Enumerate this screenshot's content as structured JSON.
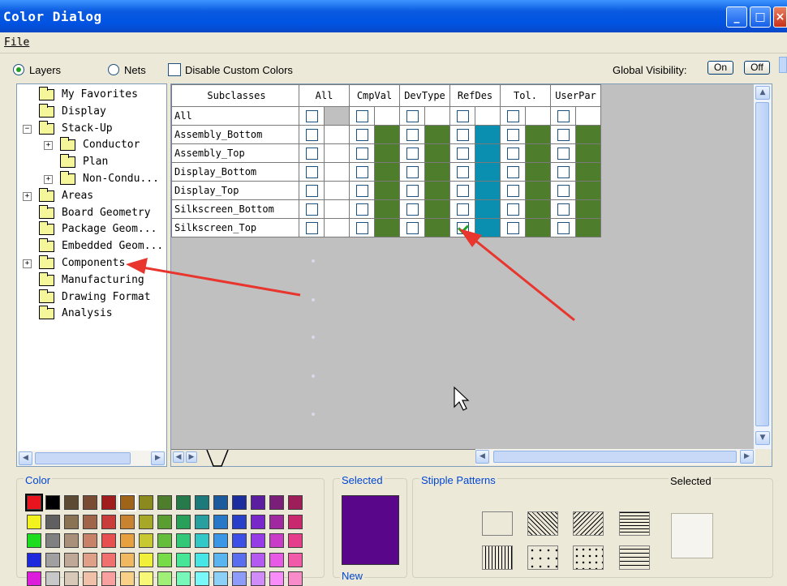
{
  "window": {
    "title": "Color Dialog",
    "minimize": "_",
    "maximize": "□",
    "close": "×"
  },
  "menu": {
    "file": "File"
  },
  "options": {
    "layers_label": "Layers",
    "nets_label": "Nets",
    "disable_custom_colors": "Disable Custom Colors",
    "global_visibility_label": "Global Visibility:",
    "on_button": "On",
    "off_button": "Off"
  },
  "tree": [
    {
      "label": "My Favorites",
      "level": 0,
      "expander": ""
    },
    {
      "label": "Display",
      "level": 0,
      "expander": ""
    },
    {
      "label": "Stack-Up",
      "level": 0,
      "expander": "−"
    },
    {
      "label": "Conductor",
      "level": 1,
      "expander": "+"
    },
    {
      "label": "Plan",
      "level": 1,
      "expander": ""
    },
    {
      "label": "Non-Condu...",
      "level": 1,
      "expander": "+"
    },
    {
      "label": "Areas",
      "level": 0,
      "expander": "+"
    },
    {
      "label": "Board Geometry",
      "level": 0,
      "expander": ""
    },
    {
      "label": "Package Geom...",
      "level": 0,
      "expander": ""
    },
    {
      "label": "Embedded Geom...",
      "level": 0,
      "expander": ""
    },
    {
      "label": "Components",
      "level": 0,
      "expander": "+"
    },
    {
      "label": "Manufacturing",
      "level": 0,
      "expander": ""
    },
    {
      "label": "Drawing Format",
      "level": 0,
      "expander": ""
    },
    {
      "label": "Analysis",
      "level": 0,
      "expander": ""
    }
  ],
  "grid": {
    "corner_header": "Subclasses",
    "columns": [
      "All",
      "CmpVal",
      "DevType",
      "RefDes",
      "Tol.",
      "UserPar"
    ],
    "column_colors": [
      "#c0c0c0",
      "#4e7d2c",
      "#4e7d2c",
      "#0b8fb0",
      "#4e7d2c",
      "#4e7d2c"
    ],
    "rows": [
      {
        "name": "All",
        "checked": [
          false,
          false,
          false,
          false,
          false,
          false
        ]
      },
      {
        "name": "Assembly_Bottom",
        "checked": [
          false,
          false,
          false,
          false,
          false,
          false
        ]
      },
      {
        "name": "Assembly_Top",
        "checked": [
          false,
          false,
          false,
          false,
          false,
          false
        ]
      },
      {
        "name": "Display_Bottom",
        "checked": [
          false,
          false,
          false,
          false,
          false,
          false
        ]
      },
      {
        "name": "Display_Top",
        "checked": [
          false,
          false,
          false,
          false,
          false,
          false
        ]
      },
      {
        "name": "Silkscreen_Bottom",
        "checked": [
          false,
          false,
          false,
          false,
          false,
          false
        ]
      },
      {
        "name": "Silkscreen_Top",
        "checked": [
          false,
          false,
          false,
          true,
          false,
          false
        ]
      }
    ]
  },
  "color_panel": {
    "label": "Color",
    "swatches": [
      [
        "#e8141e",
        "#000000",
        "#5d4a35",
        "#7a4b33",
        "#a01e1e",
        "#a06418",
        "#8a8a1e",
        "#4e7d2c",
        "#267a4a",
        "#1c7a7a",
        "#1c5a9e",
        "#1c2e9e",
        "#5a1e9e",
        "#7a1e7a",
        "#9e1e5a"
      ],
      [
        "#f2f21e",
        "#606060",
        "#8a7355",
        "#a06448",
        "#c83c3c",
        "#c88230",
        "#a8a828",
        "#5a9e32",
        "#28a05a",
        "#28a0a0",
        "#2878c8",
        "#2840c8",
        "#7828c8",
        "#a028a0",
        "#c8286e"
      ],
      [
        "#1edc1e",
        "#808080",
        "#a8907a",
        "#c8826a",
        "#e65050",
        "#e6a040",
        "#c8c832",
        "#64be3c",
        "#32c878",
        "#32c8c8",
        "#3c96e6",
        "#3c50e6",
        "#963ce6",
        "#c83cc8",
        "#e63c8c"
      ],
      [
        "#1e28dc",
        "#a0a0a0",
        "#c0a898",
        "#e0a088",
        "#f07070",
        "#f0b860",
        "#f0f03c",
        "#78dc46",
        "#46e696",
        "#46e6e6",
        "#5ab4f0",
        "#5a6ef0",
        "#b45af0",
        "#e65ae6",
        "#f05aa8"
      ],
      [
        "#dc1edc",
        "#c8c8c8",
        "#d8c8b8",
        "#f0c0a8",
        "#f8a0a0",
        "#f8d088",
        "#f8f878",
        "#a0f078",
        "#78f8b8",
        "#78f8f8",
        "#8cd0f8",
        "#8c9cf8",
        "#d08cf8",
        "#f88cf8",
        "#f88cc8"
      ]
    ]
  },
  "selected_panel": {
    "label": "Selected",
    "color": "#5a068a",
    "new_label": "New"
  },
  "stipple_panel": {
    "label": "Stipple Patterns",
    "selected_label": "Selected"
  }
}
